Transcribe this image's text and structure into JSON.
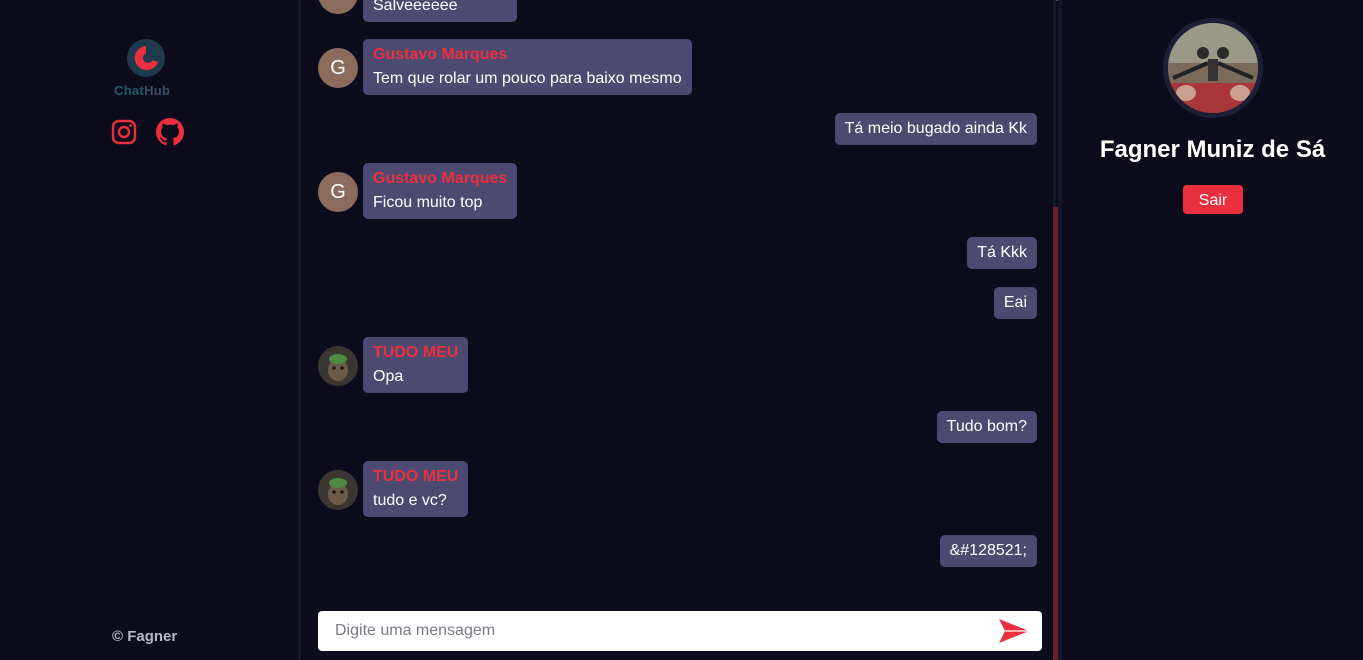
{
  "sidebar": {
    "logo": {
      "name_part1": "Chat",
      "name_part2": "Hub",
      "icon": "chathub-logo-icon"
    },
    "social": [
      {
        "icon": "instagram-icon",
        "color": "#ea2f3e"
      },
      {
        "icon": "github-icon",
        "color": "#ea2f3e"
      }
    ],
    "footer": "© Fagner"
  },
  "chat": {
    "messages": [
      {
        "id": 0,
        "mine": false,
        "author": "",
        "text": "Salveeeeee",
        "avatar_letter": "G"
      },
      {
        "id": 1,
        "mine": false,
        "author": "Gustavo Marques",
        "text": "Tem que rolar um pouco para baixo mesmo",
        "avatar_letter": "G"
      },
      {
        "id": 2,
        "mine": true,
        "text": "Tá meio bugado ainda Kk"
      },
      {
        "id": 3,
        "mine": false,
        "author": "Gustavo Marques",
        "text": "Ficou muito top",
        "avatar_letter": "G"
      },
      {
        "id": 4,
        "mine": true,
        "text": "Tá Kkk"
      },
      {
        "id": 5,
        "mine": true,
        "text": "Eai"
      },
      {
        "id": 6,
        "mine": false,
        "author": "TUDO MEU",
        "text": "Opa",
        "avatar_type": "photo"
      },
      {
        "id": 7,
        "mine": true,
        "text": "Tudo bom?"
      },
      {
        "id": 8,
        "mine": false,
        "author": "TUDO MEU",
        "text": "tudo e vc?",
        "avatar_type": "photo"
      },
      {
        "id": 9,
        "mine": true,
        "text": "&#128521;"
      }
    ],
    "input": {
      "placeholder": "Digite uma mensagem",
      "value": ""
    },
    "send_icon": "send-icon"
  },
  "profile": {
    "name": "Fagner Muniz de Sá",
    "logout_label": "Sair"
  },
  "colors": {
    "background": "#0d0c1d",
    "bubble": "#4c4a70",
    "accent": "#ea2f3e"
  }
}
